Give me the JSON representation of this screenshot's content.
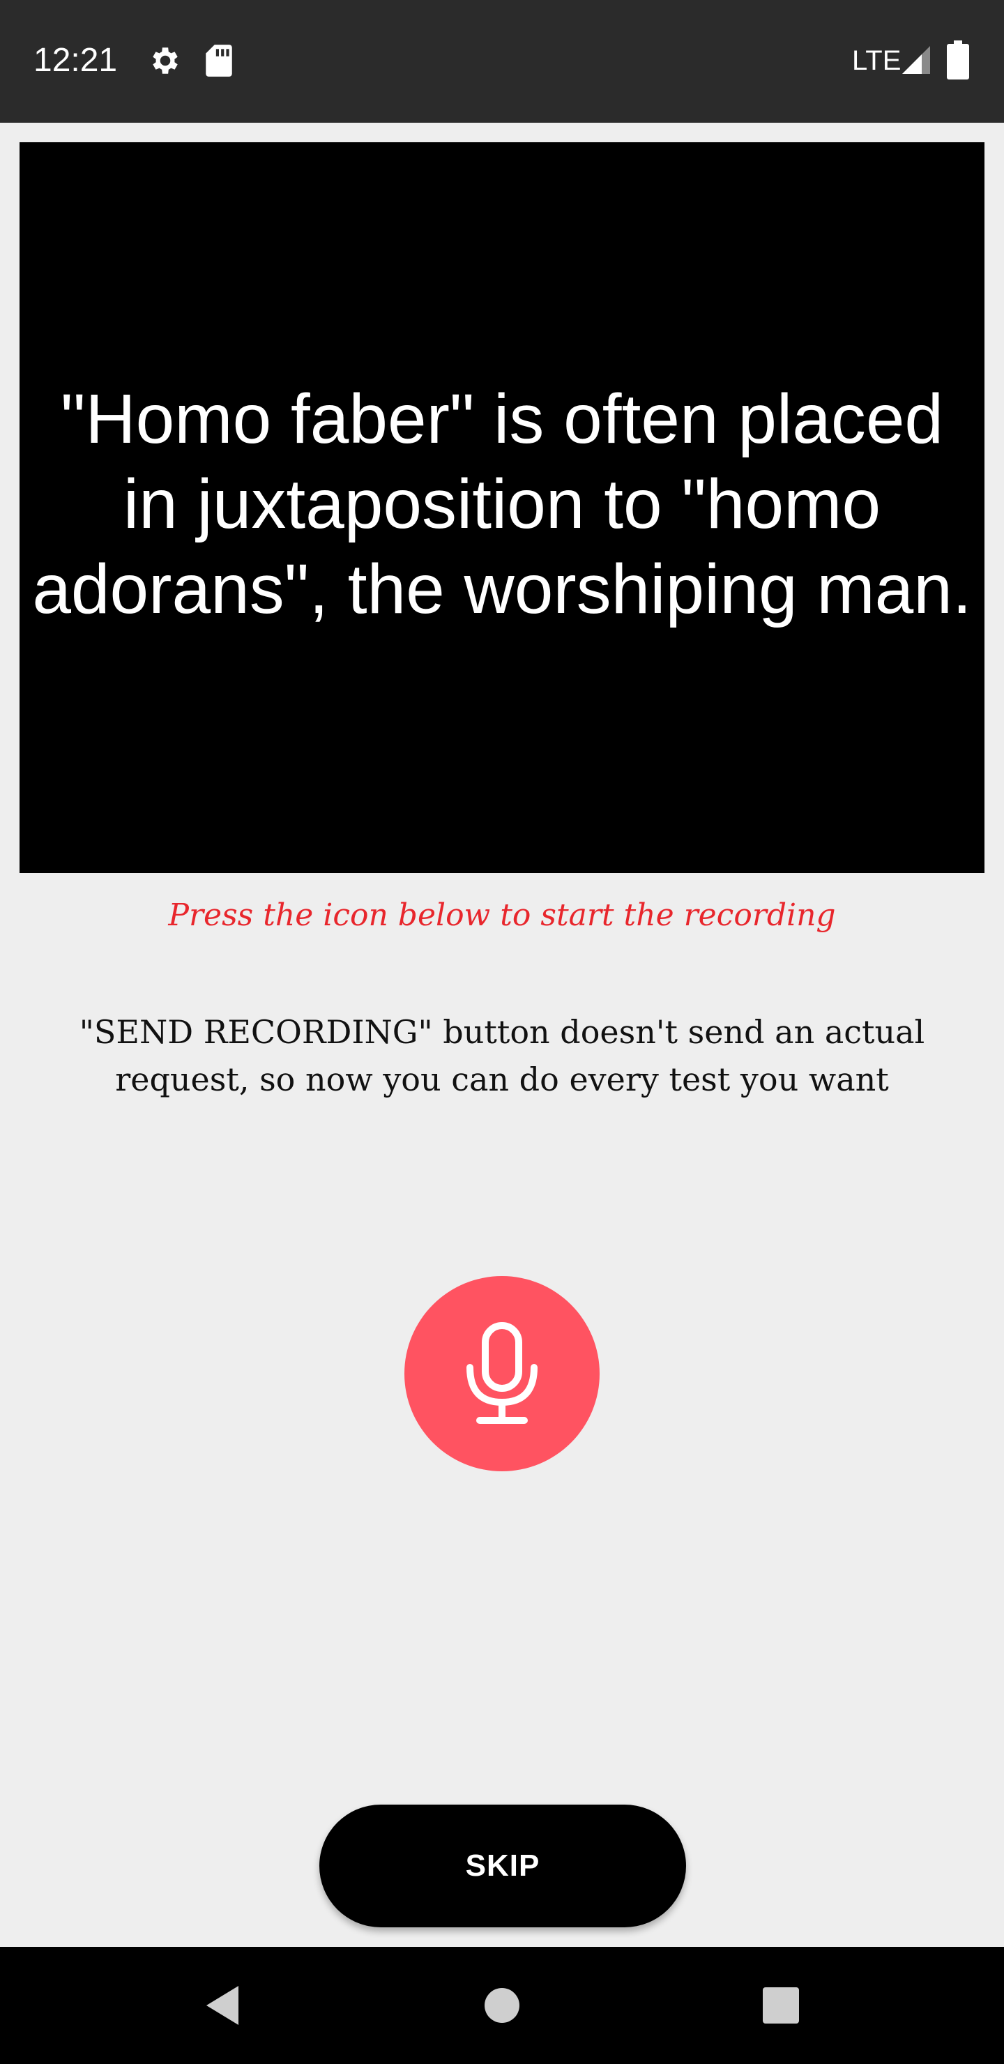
{
  "status_bar": {
    "time": "12:21",
    "network": "LTE",
    "icons": [
      "gear-icon",
      "sd-card-icon",
      "signal-icon",
      "battery-icon"
    ]
  },
  "prompt": {
    "text": "\"Homo faber\" is often placed in juxtaposition to \"homo adorans\", the worshiping man."
  },
  "instruction": {
    "text": "Press the icon below to start the recording",
    "color": "#e8262c"
  },
  "note": {
    "text": "\"SEND RECORDING\" button doesn't send an actual request, so now you can do every test you want"
  },
  "record_button": {
    "icon": "microphone-icon",
    "color": "#ff5361"
  },
  "skip_button": {
    "label": "SKIP"
  },
  "nav_bar": {
    "buttons": [
      "back-icon",
      "home-icon",
      "recents-icon"
    ]
  }
}
